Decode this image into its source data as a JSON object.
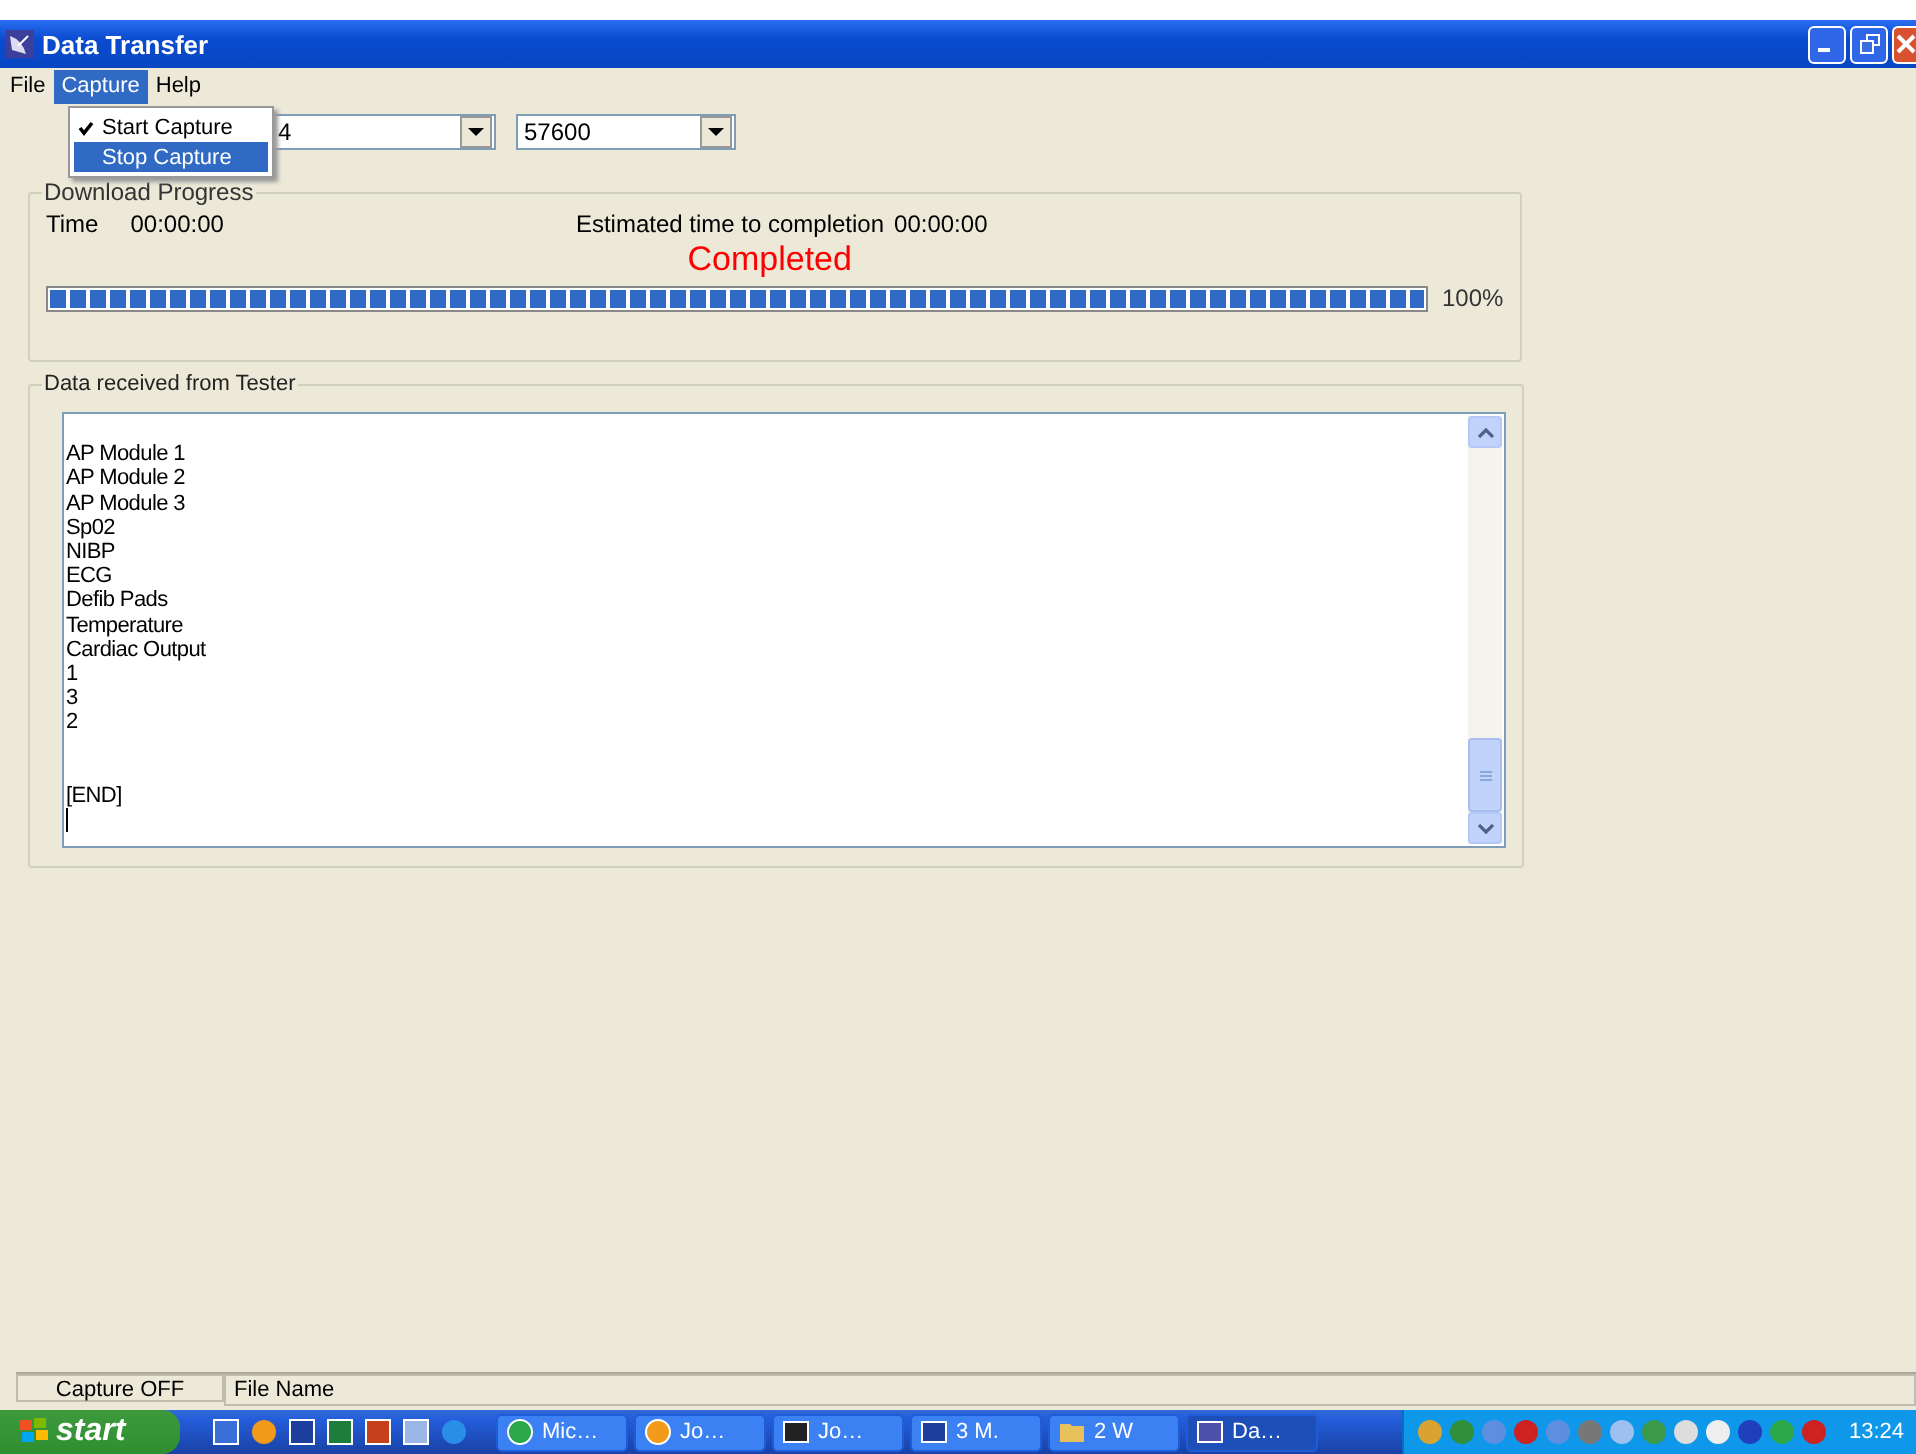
{
  "window": {
    "title": "Data Transfer"
  },
  "menu_bar": [
    {
      "label": "File",
      "selected": false
    },
    {
      "label": "Capture",
      "selected": true
    },
    {
      "label": "Help",
      "selected": false
    }
  ],
  "capture_menu": [
    {
      "label": "Start Capture",
      "checked": true,
      "selected": false
    },
    {
      "label": "Stop Capture",
      "checked": false,
      "selected": true
    }
  ],
  "port_combo": {
    "value": "4"
  },
  "baud_combo": {
    "value": "57600"
  },
  "download_progress": {
    "title": "Download Progress",
    "time_label": "Time",
    "time_value": "00:00:00",
    "eta_label": "Estimated time to completion",
    "eta_value": "00:00:00",
    "status": "Completed",
    "level": 1,
    "percent": "100%"
  },
  "data_received": {
    "title": "Data received from Tester",
    "text": "\nAP Module 1\nAP Module 2\nAP Module 3\nSp02\nNIBP\nECG\nDefib Pads\nTemperature\nCardiac Output\n1\n3\n2\n\n\n[END]"
  },
  "status_bar": [
    "Capture OFF",
    "File Name"
  ],
  "taskbar": {
    "start": "start",
    "tasks": [
      {
        "label": "Mic…",
        "kind": "green",
        "selected": false
      },
      {
        "label": "Jo…",
        "kind": "orange",
        "selected": false
      },
      {
        "label": "Jo…",
        "kind": "console",
        "selected": false
      },
      {
        "label": "3 M.",
        "kind": "word",
        "selected": false
      },
      {
        "label": "2 W",
        "kind": "folder",
        "selected": false
      },
      {
        "label": "Da…",
        "kind": "dish",
        "selected": true
      }
    ],
    "clock": "13:24"
  }
}
